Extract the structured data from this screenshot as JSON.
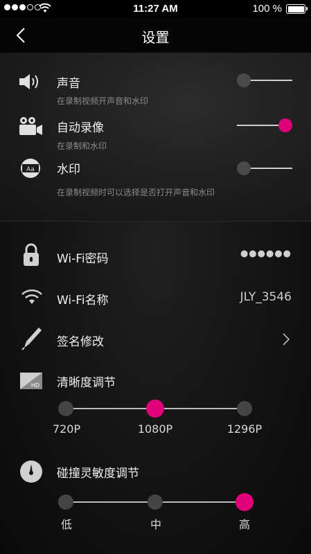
{
  "status_bar": {
    "time": "11:27 AM",
    "battery": "100 %",
    "signal_bars_filled": 3,
    "signal_bars_total": 5
  },
  "nav": {
    "title": "设置",
    "back_icon": "chevron-left-icon"
  },
  "toggles": [
    {
      "icon": "speaker-icon",
      "label": "声音",
      "description": "在录制视频开声音和水印",
      "on": false
    },
    {
      "icon": "camera-icon",
      "label": "自动录像",
      "description": "在录制和水印",
      "on": true
    },
    {
      "icon": "watermark-icon",
      "label": "水印",
      "description": "在录制视频时可以选择是否打开声音和水印",
      "on": false
    }
  ],
  "settings": [
    {
      "icon": "lock-icon",
      "label": "Wi-Fi密码",
      "value": "●●●●●●"
    },
    {
      "icon": "wifi-icon",
      "label": "Wi-Fi名称",
      "value": "JLY_3546"
    },
    {
      "icon": "pen-icon",
      "label": "签名修改",
      "value": ""
    }
  ],
  "resolution": {
    "icon": "hd-icon",
    "label": "清晰度调节",
    "options": [
      "720P",
      "1080P",
      "1296P"
    ],
    "selected_index": 1
  },
  "sensitivity": {
    "icon": "gauge-icon",
    "label": "碰撞灵敏度调节",
    "options": [
      "低",
      "中",
      "高"
    ],
    "selected_index": 2
  },
  "colors": {
    "accent": "#e0007a",
    "background": "#111111",
    "knob_off": "#4a4a4a"
  }
}
